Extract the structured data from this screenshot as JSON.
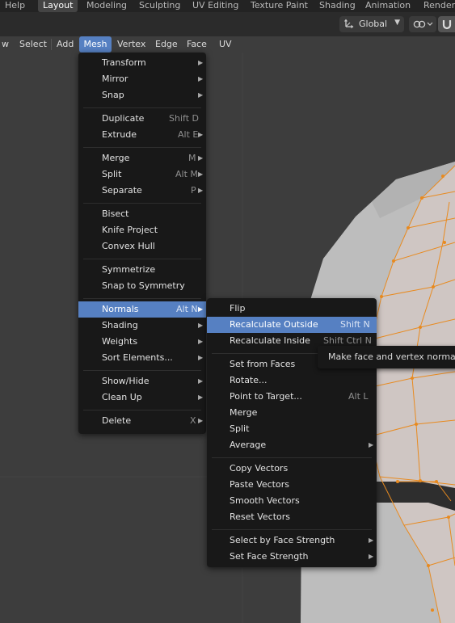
{
  "topbar": {
    "tabs": [
      {
        "label": "Help"
      },
      {
        "label": "Layout"
      },
      {
        "label": "Modeling"
      },
      {
        "label": "Sculpting"
      },
      {
        "label": "UV Editing"
      },
      {
        "label": "Texture Paint"
      },
      {
        "label": "Shading"
      },
      {
        "label": "Animation"
      },
      {
        "label": "Renderi"
      }
    ],
    "active_tab": "Layout"
  },
  "header": {
    "orientation": {
      "value": "Global",
      "icon": "transform-orientation-icon"
    },
    "snap_icon": "snap-link-icon",
    "magnet_icon": "magnet-icon"
  },
  "menubar": {
    "items": [
      {
        "label": "w"
      },
      {
        "label": "Select"
      },
      {
        "label": "Add"
      },
      {
        "label": "Mesh"
      },
      {
        "label": "Vertex"
      },
      {
        "label": "Edge"
      },
      {
        "label": "Face"
      },
      {
        "label": "UV"
      }
    ],
    "active": "Mesh"
  },
  "mesh_menu": {
    "items": [
      {
        "label": "Transform",
        "shortcut": "",
        "submenu": true
      },
      {
        "label": "Mirror",
        "shortcut": "",
        "submenu": true
      },
      {
        "label": "Snap",
        "shortcut": "",
        "submenu": true
      },
      {
        "label": "Duplicate",
        "shortcut": "Shift D",
        "submenu": false
      },
      {
        "label": "Extrude",
        "shortcut": "Alt E",
        "submenu": true
      },
      {
        "label": "Merge",
        "shortcut": "M",
        "submenu": true
      },
      {
        "label": "Split",
        "shortcut": "Alt M",
        "submenu": true
      },
      {
        "label": "Separate",
        "shortcut": "P",
        "submenu": true
      },
      {
        "label": "Bisect",
        "shortcut": "",
        "submenu": false
      },
      {
        "label": "Knife Project",
        "shortcut": "",
        "submenu": false
      },
      {
        "label": "Convex Hull",
        "shortcut": "",
        "submenu": false
      },
      {
        "label": "Symmetrize",
        "shortcut": "",
        "submenu": false
      },
      {
        "label": "Snap to Symmetry",
        "shortcut": "",
        "submenu": false
      },
      {
        "label": "Normals",
        "shortcut": "Alt N",
        "submenu": true,
        "highlighted": true
      },
      {
        "label": "Shading",
        "shortcut": "",
        "submenu": true
      },
      {
        "label": "Weights",
        "shortcut": "",
        "submenu": true
      },
      {
        "label": "Sort Elements...",
        "shortcut": "",
        "submenu": true
      },
      {
        "label": "Show/Hide",
        "shortcut": "",
        "submenu": true
      },
      {
        "label": "Clean Up",
        "shortcut": "",
        "submenu": true
      },
      {
        "label": "Delete",
        "shortcut": "X",
        "submenu": true
      }
    ]
  },
  "normals_menu": {
    "items": [
      {
        "label": "Flip",
        "shortcut": "",
        "submenu": false
      },
      {
        "label": "Recalculate Outside",
        "shortcut": "Shift N",
        "submenu": false,
        "highlighted": true
      },
      {
        "label": "Recalculate Inside",
        "shortcut": "Shift Ctrl N",
        "submenu": false
      },
      {
        "label": "Set from Faces",
        "shortcut": "",
        "submenu": false
      },
      {
        "label": "Rotate...",
        "shortcut": "",
        "submenu": false
      },
      {
        "label": "Point to Target...",
        "shortcut": "Alt L",
        "submenu": false
      },
      {
        "label": "Merge",
        "shortcut": "",
        "submenu": false
      },
      {
        "label": "Split",
        "shortcut": "",
        "submenu": false
      },
      {
        "label": "Average",
        "shortcut": "",
        "submenu": true
      },
      {
        "label": "Copy Vectors",
        "shortcut": "",
        "submenu": false
      },
      {
        "label": "Paste Vectors",
        "shortcut": "",
        "submenu": false
      },
      {
        "label": "Smooth Vectors",
        "shortcut": "",
        "submenu": false
      },
      {
        "label": "Reset Vectors",
        "shortcut": "",
        "submenu": false
      },
      {
        "label": "Select by Face Strength",
        "shortcut": "",
        "submenu": true
      },
      {
        "label": "Set Face Strength",
        "shortcut": "",
        "submenu": true
      }
    ]
  },
  "tooltip": {
    "text": "Make face and vertex normals p"
  },
  "colors": {
    "accent": "#5680c2",
    "menu_bg": "#181818",
    "viewport_bg": "#3d3d3d",
    "mesh_face": "#cfc9c6",
    "edge_selected": "#e88a1f"
  }
}
